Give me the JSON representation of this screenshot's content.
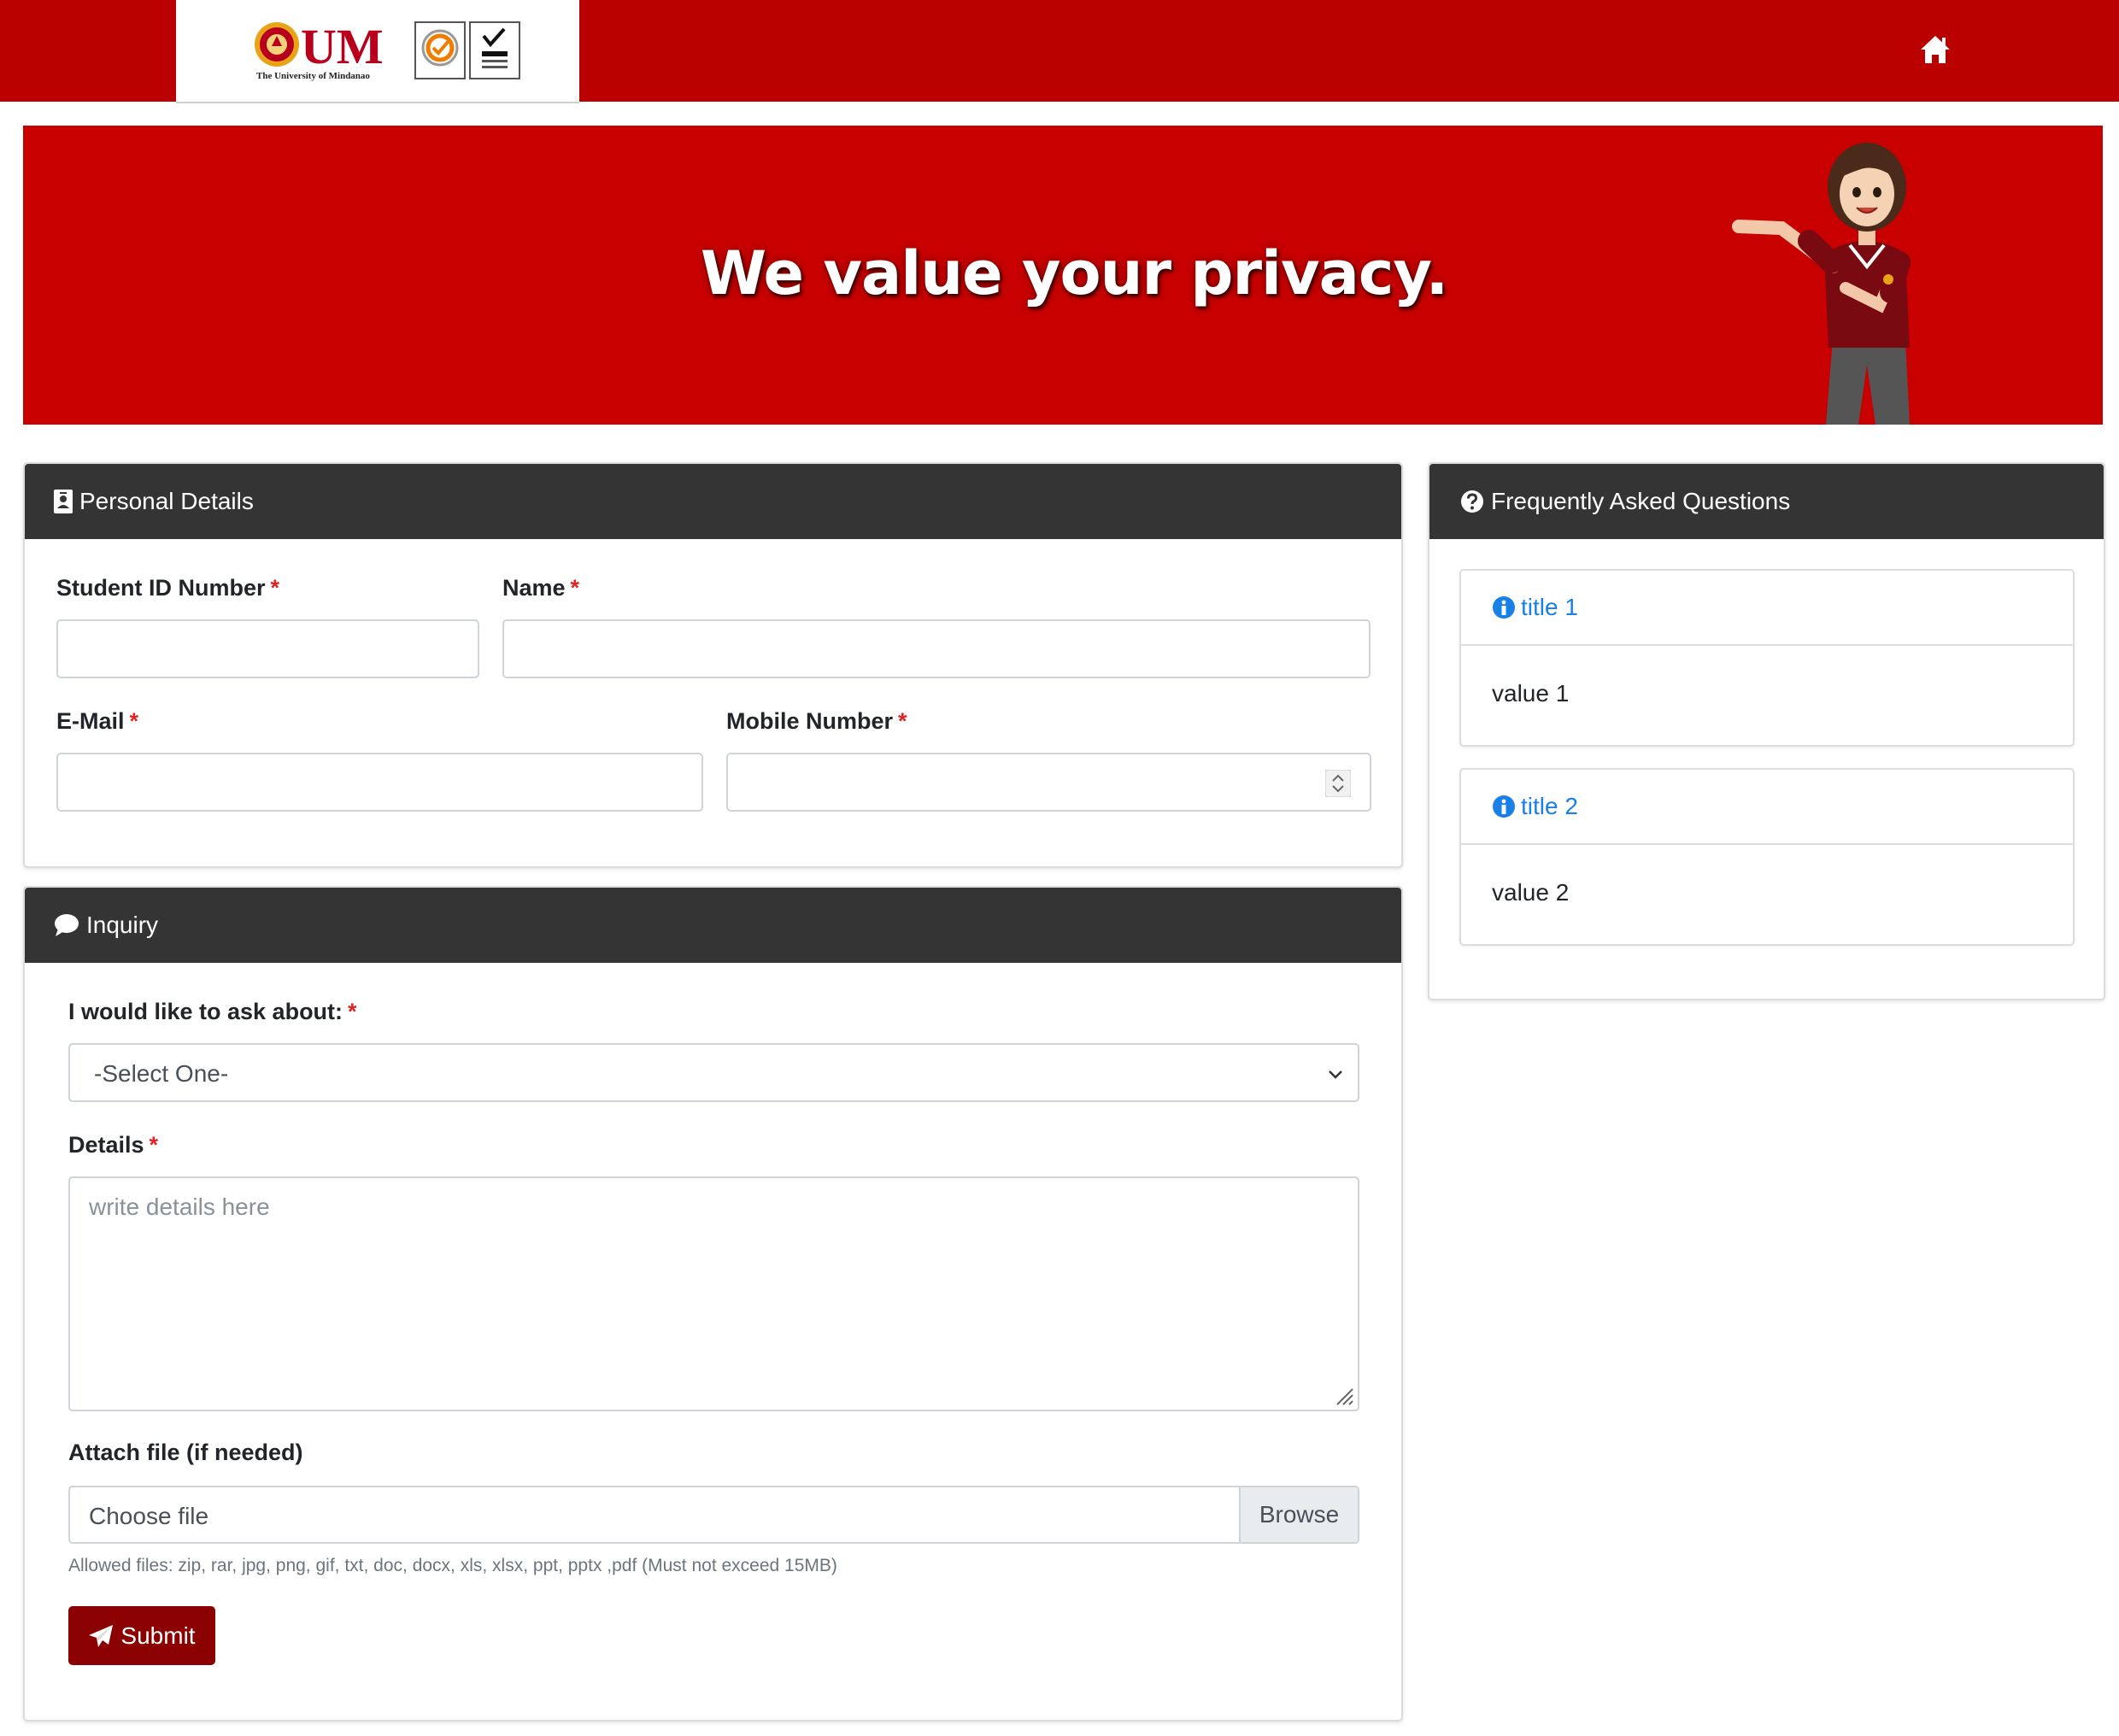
{
  "navbar": {
    "logo_text": "UM",
    "logo_subtitle": "The University of Mindanao",
    "home_icon": "home-icon",
    "color": "#bb0000"
  },
  "banner": {
    "headline": "We value your privacy.",
    "color": "#c80000"
  },
  "personal_details": {
    "title": "Personal Details",
    "icon": "id-badge-icon",
    "fields": {
      "student_id": {
        "label": "Student ID Number",
        "required": "*",
        "value": ""
      },
      "name": {
        "label": "Name",
        "required": "*",
        "value": ""
      },
      "email": {
        "label": "E-Mail",
        "required": "*",
        "value": ""
      },
      "mobile": {
        "label": "Mobile Number",
        "required": "*",
        "value": ""
      }
    }
  },
  "inquiry": {
    "title": "Inquiry",
    "icon": "comment-icon",
    "topic": {
      "label": "I would like to ask about:",
      "required": "*",
      "selected": "-Select One-"
    },
    "details": {
      "label": "Details",
      "required": "*",
      "placeholder": "write details here"
    },
    "attachment": {
      "label": "Attach file (if needed)",
      "placeholder": "Choose file",
      "browse_label": "Browse",
      "hint": "Allowed files: zip, rar, jpg, png, gif, txt, doc, docx, xls, xlsx, ppt, pptx ,pdf (Must not exceed 15MB)"
    },
    "submit_label": "Submit",
    "submit_color": "#8b0000"
  },
  "faq": {
    "title": "Frequently Asked Questions",
    "icon": "question-circle-icon",
    "items": [
      {
        "title": "title 1",
        "value": "value 1"
      },
      {
        "title": "title 2",
        "value": "value 2"
      }
    ],
    "link_color": "#1a7fe6"
  },
  "theme": {
    "header_dark": "#343434",
    "required_color": "#e02424"
  }
}
